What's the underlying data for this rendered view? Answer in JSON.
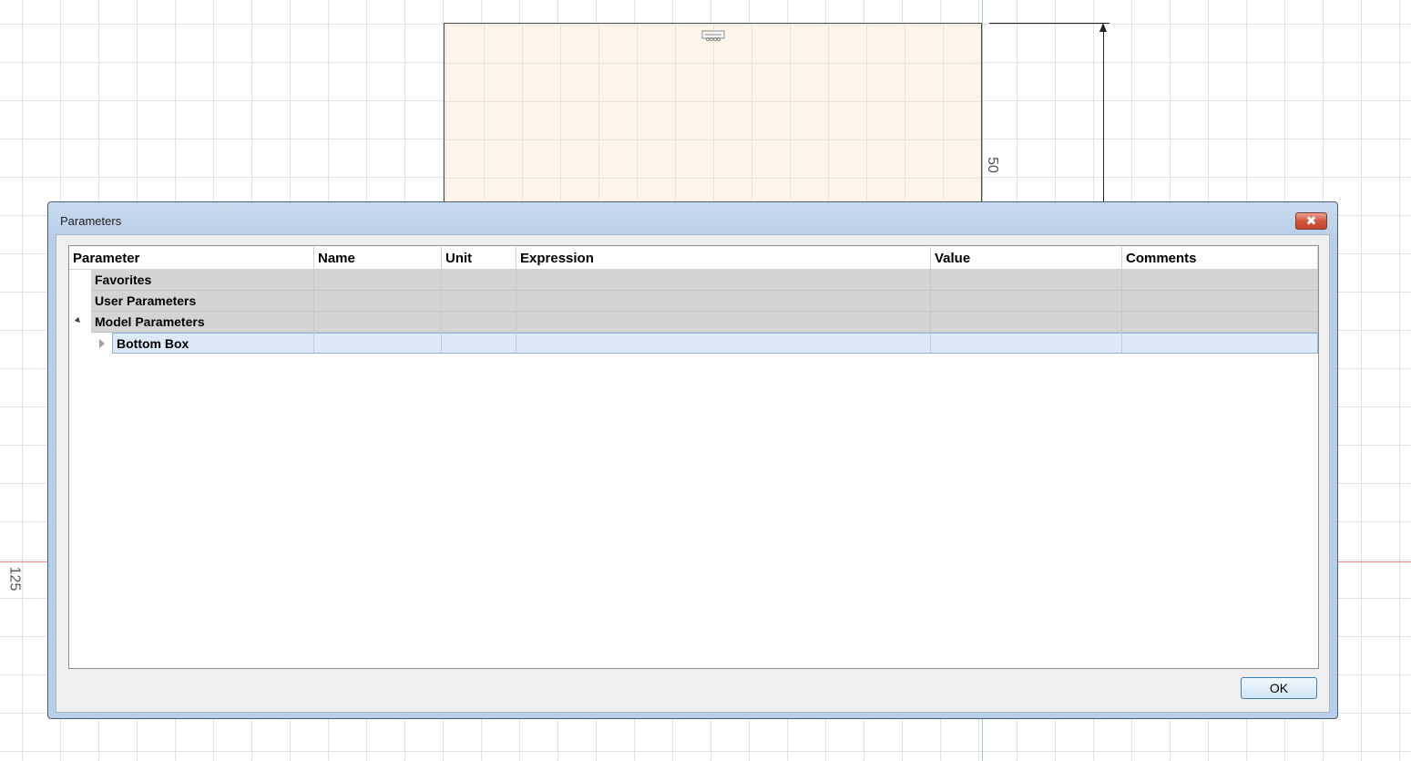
{
  "canvas": {
    "dimension_vertical": "50",
    "dimension_left": "125"
  },
  "dialog": {
    "title": "Parameters",
    "close_label": "✖",
    "ok_label": "OK"
  },
  "table": {
    "columns": [
      "Parameter",
      "Name",
      "Unit",
      "Expression",
      "Value",
      "Comments"
    ],
    "groups": [
      {
        "label": "Favorites"
      },
      {
        "label": "User Parameters"
      },
      {
        "label": "Model Parameters"
      }
    ],
    "components": [
      {
        "label": "Bottom Box"
      }
    ]
  },
  "colors": {
    "selection": "#dce9f9",
    "group_background": "#d4d4d4",
    "close_button": "#c5412a"
  }
}
